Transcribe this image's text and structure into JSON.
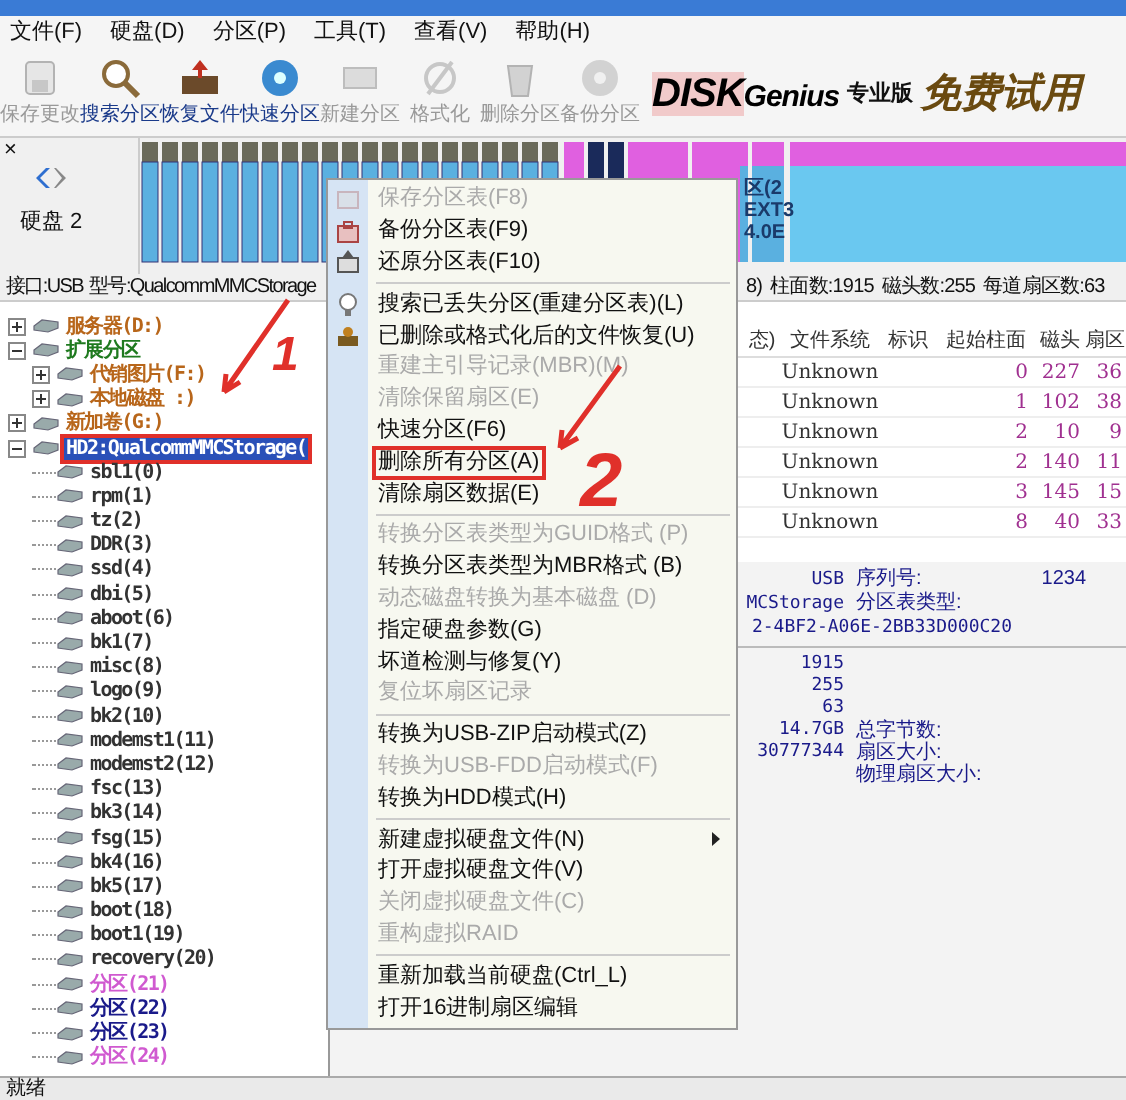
{
  "menubar": [
    "文件(F)",
    "硬盘(D)",
    "分区(P)",
    "工具(T)",
    "查看(V)",
    "帮助(H)"
  ],
  "toolbar": [
    {
      "label": "保存更改",
      "disabled": true
    },
    {
      "label": "搜索分区",
      "disabled": false
    },
    {
      "label": "恢复文件",
      "disabled": false
    },
    {
      "label": "快速分区",
      "disabled": false
    },
    {
      "label": "新建分区",
      "disabled": true
    },
    {
      "label": "格式化",
      "disabled": true
    },
    {
      "label": "删除分区",
      "disabled": true
    },
    {
      "label": "备份分区",
      "disabled": true
    }
  ],
  "logo": {
    "brand_a": "DISK",
    "brand_b": "Genius",
    "edition": "专业版",
    "promo": "免费试用"
  },
  "disk_panel": {
    "close": "×",
    "label": "硬盘 2",
    "map_labels": [
      "区(2",
      "EXT3",
      "4.0E"
    ]
  },
  "disk_info": {
    "left": [
      "接口:USB",
      "型号:QualcommMMCStorage"
    ],
    "right": [
      "8)",
      "柱面数:1915",
      "磁头数:255",
      "每道扇区数:63"
    ]
  },
  "tree": [
    {
      "label": "服务器(D:)",
      "color": "#b8661a",
      "expanded": false,
      "selected": false
    },
    {
      "label": "扩展分区",
      "color": "#1f7a1f",
      "expanded": true,
      "selected": false,
      "children": [
        {
          "label": "代销图片(F:)",
          "color": "#b8661a",
          "expanded": false,
          "selected": false
        },
        {
          "label": "本地磁盘 :)",
          "color": "#b8661a",
          "expanded": false,
          "selected": false
        }
      ]
    },
    {
      "label": "新加卷(G:)",
      "color": "#b8661a",
      "expanded": false,
      "selected": false
    },
    {
      "label": "HD2:QualcommMMCStorage(",
      "color": "#2a50b8",
      "expanded": true,
      "selected": true,
      "annotated": true,
      "children": [
        {
          "label": "sbl1(0)",
          "color": "#333333",
          "selected": false
        },
        {
          "label": "rpm(1)",
          "color": "#333333",
          "selected": false
        },
        {
          "label": "tz(2)",
          "color": "#333333",
          "selected": false
        },
        {
          "label": "DDR(3)",
          "color": "#333333",
          "selected": false
        },
        {
          "label": "ssd(4)",
          "color": "#333333",
          "selected": false
        },
        {
          "label": "dbi(5)",
          "color": "#333333",
          "selected": false
        },
        {
          "label": "aboot(6)",
          "color": "#333333",
          "selected": false
        },
        {
          "label": "bk1(7)",
          "color": "#333333",
          "selected": false
        },
        {
          "label": "misc(8)",
          "color": "#333333",
          "selected": false
        },
        {
          "label": "logo(9)",
          "color": "#333333",
          "selected": false
        },
        {
          "label": "bk2(10)",
          "color": "#333333",
          "selected": false
        },
        {
          "label": "modemst1(11)",
          "color": "#333333",
          "selected": false
        },
        {
          "label": "modemst2(12)",
          "color": "#333333",
          "selected": false
        },
        {
          "label": "fsc(13)",
          "color": "#333333",
          "selected": false
        },
        {
          "label": "bk3(14)",
          "color": "#333333",
          "selected": false
        },
        {
          "label": "fsg(15)",
          "color": "#333333",
          "selected": false
        },
        {
          "label": "bk4(16)",
          "color": "#333333",
          "selected": false
        },
        {
          "label": "bk5(17)",
          "color": "#333333",
          "selected": false
        },
        {
          "label": "boot(18)",
          "color": "#333333",
          "selected": false
        },
        {
          "label": "boot1(19)",
          "color": "#333333",
          "selected": false
        },
        {
          "label": "recovery(20)",
          "color": "#333333",
          "selected": false
        },
        {
          "label": "分区(21)",
          "color": "#d05ad0",
          "selected": false
        },
        {
          "label": "分区(22)",
          "color": "#1a1a8a",
          "selected": false
        },
        {
          "label": "分区(23)",
          "color": "#1a1a8a",
          "selected": false
        },
        {
          "label": "分区(24)",
          "color": "#d05ad0",
          "selected": false
        }
      ]
    }
  ],
  "table": {
    "columns": [
      "态)",
      "文件系统",
      "标识",
      "起始柱面",
      "磁头",
      "扇区"
    ],
    "rows": [
      {
        "file_system": "Unknown",
        "start_cylinder": "0",
        "head": "227",
        "sector": "36"
      },
      {
        "file_system": "Unknown",
        "start_cylinder": "1",
        "head": "102",
        "sector": "38"
      },
      {
        "file_system": "Unknown",
        "start_cylinder": "2",
        "head": "10",
        "sector": "9"
      },
      {
        "file_system": "Unknown",
        "start_cylinder": "2",
        "head": "140",
        "sector": "11"
      },
      {
        "file_system": "Unknown",
        "start_cylinder": "3",
        "head": "145",
        "sector": "15"
      },
      {
        "file_system": "Unknown",
        "start_cylinder": "8",
        "head": "40",
        "sector": "33"
      }
    ]
  },
  "details_top": {
    "values": [
      "USB",
      "MCStorage",
      "2-4BF2-A06E-2BB33D000C20"
    ],
    "labels": [
      "序列号:",
      "分区表类型:"
    ],
    "serial": "1234"
  },
  "details_bottom": {
    "values": [
      "1915",
      "255",
      "63",
      "14.7GB",
      "30777344"
    ],
    "labels": [
      "总字节数:",
      "扇区大小:",
      "物理扇区大小:"
    ]
  },
  "context_menu": [
    {
      "kind": "item",
      "label": "保存分区表(F8)",
      "disabled": true
    },
    {
      "kind": "item",
      "label": "备份分区表(F9)",
      "disabled": false
    },
    {
      "kind": "item",
      "label": "还原分区表(F10)",
      "disabled": false
    },
    {
      "kind": "separator"
    },
    {
      "kind": "item",
      "label": "搜索已丢失分区(重建分区表)(L)",
      "disabled": false
    },
    {
      "kind": "item",
      "label": "已删除或格式化后的文件恢复(U)",
      "disabled": false
    },
    {
      "kind": "item",
      "label": "重建主引导记录(MBR)(M)",
      "disabled": true
    },
    {
      "kind": "item",
      "label": "清除保留扇区(E)",
      "disabled": true
    },
    {
      "kind": "item",
      "label": "快速分区(F6)",
      "disabled": false
    },
    {
      "kind": "item",
      "label": "删除所有分区(A)",
      "disabled": false,
      "annotated": true
    },
    {
      "kind": "item",
      "label": "清除扇区数据(E)",
      "disabled": false
    },
    {
      "kind": "separator"
    },
    {
      "kind": "item",
      "label": "转换分区表类型为GUID格式 (P)",
      "disabled": true
    },
    {
      "kind": "item",
      "label": "转换分区表类型为MBR格式 (B)",
      "disabled": false
    },
    {
      "kind": "item",
      "label": "动态磁盘转换为基本磁盘 (D)",
      "disabled": true
    },
    {
      "kind": "item",
      "label": "指定硬盘参数(G)",
      "disabled": false
    },
    {
      "kind": "item",
      "label": "坏道检测与修复(Y)",
      "disabled": false
    },
    {
      "kind": "item",
      "label": "复位坏扇区记录",
      "disabled": true
    },
    {
      "kind": "separator"
    },
    {
      "kind": "item",
      "label": "转换为USB-ZIP启动模式(Z)",
      "disabled": false
    },
    {
      "kind": "item",
      "label": "转换为USB-FDD启动模式(F)",
      "disabled": true
    },
    {
      "kind": "item",
      "label": "转换为HDD模式(H)",
      "disabled": false
    },
    {
      "kind": "separator"
    },
    {
      "kind": "item",
      "label": "新建虚拟硬盘文件(N)",
      "disabled": false,
      "submenu": true
    },
    {
      "kind": "item",
      "label": "打开虚拟硬盘文件(V)",
      "disabled": false
    },
    {
      "kind": "item",
      "label": "关闭虚拟硬盘文件(C)",
      "disabled": true
    },
    {
      "kind": "item",
      "label": "重构虚拟RAID",
      "disabled": true
    },
    {
      "kind": "separator"
    },
    {
      "kind": "item",
      "label": "重新加载当前硬盘(Ctrl_L)",
      "disabled": false
    },
    {
      "kind": "item",
      "label": "打开16进制扇区编辑",
      "disabled": false
    }
  ],
  "annotations": [
    "1",
    "2"
  ],
  "status_bar": "就绪"
}
